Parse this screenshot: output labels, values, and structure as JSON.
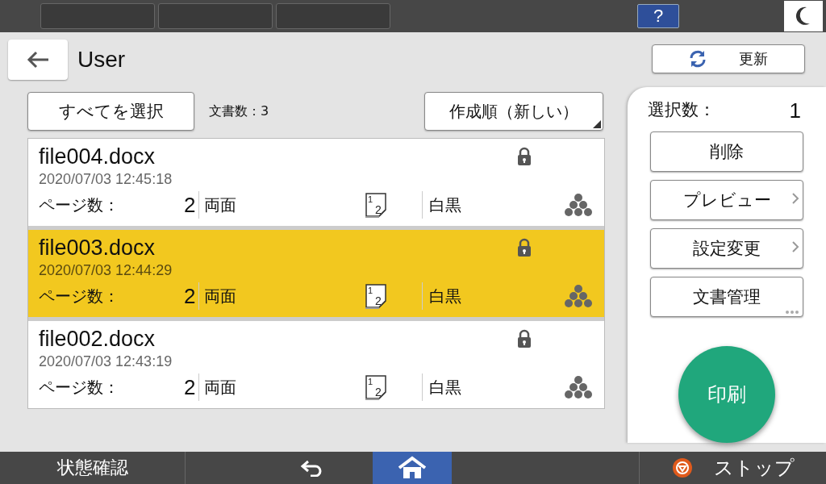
{
  "top_bar": {
    "help": "?"
  },
  "header": {
    "title": "User",
    "refresh": "更新"
  },
  "toolbar": {
    "select_all": "すべてを選択",
    "count": "文書数：3",
    "sort": "作成順（新しい）"
  },
  "files": [
    {
      "name": "file004.docx",
      "date": "2020/07/03 12:45:18",
      "pages_label": "ページ数：",
      "pages": "2",
      "icon_front": "1",
      "icon_back": "2",
      "sides": "両面",
      "color_mode": "白黒",
      "locked": true,
      "selected": false
    },
    {
      "name": "file003.docx",
      "date": "2020/07/03 12:44:29",
      "pages_label": "ページ数：",
      "pages": "2",
      "icon_front": "1",
      "icon_back": "2",
      "sides": "両面",
      "color_mode": "白黒",
      "locked": true,
      "selected": true
    },
    {
      "name": "file002.docx",
      "date": "2020/07/03 12:43:19",
      "pages_label": "ページ数：",
      "pages": "2",
      "icon_front": "1",
      "icon_back": "2",
      "sides": "両面",
      "color_mode": "白黒",
      "locked": true,
      "selected": false
    }
  ],
  "side_panel": {
    "selected_label": "選択数：",
    "selected_count": "1",
    "buttons": [
      {
        "label": "削除",
        "kind": "plain"
      },
      {
        "label": "プレビュー",
        "kind": "chevron"
      },
      {
        "label": "設定変更",
        "kind": "chevron"
      },
      {
        "label": "文書管理",
        "kind": "more"
      }
    ],
    "print": "印刷"
  },
  "bottom_bar": {
    "status": "状態確認",
    "stop": "ストップ"
  }
}
